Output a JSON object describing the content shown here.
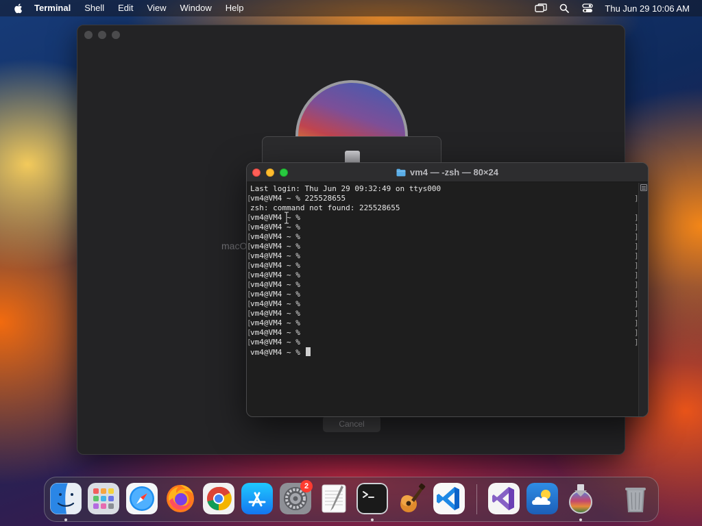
{
  "menubar": {
    "app_name": "Terminal",
    "menus": [
      "Shell",
      "Edit",
      "View",
      "Window",
      "Help"
    ],
    "clock": "Thu Jun 29  10:06 AM",
    "icons": [
      "apple-icon",
      "screen-mirroring-icon",
      "spotlight-search-icon",
      "control-center-icon"
    ]
  },
  "installer": {
    "ghost_text": "macO",
    "cancel_label": "Cancel"
  },
  "terminal": {
    "title": "vm4 — -zsh — 80×24",
    "lines": [
      "Last login: Thu Jun 29 09:32:49 on ttys000",
      "vm4@VM4 ~ % 225528655",
      "zsh: command not found: 225528655",
      "vm4@VM4 ~ %",
      "vm4@VM4 ~ %",
      "vm4@VM4 ~ %",
      "vm4@VM4 ~ %",
      "vm4@VM4 ~ %",
      "vm4@VM4 ~ %",
      "vm4@VM4 ~ %",
      "vm4@VM4 ~ %",
      "vm4@VM4 ~ %",
      "vm4@VM4 ~ %",
      "vm4@VM4 ~ %",
      "vm4@VM4 ~ %",
      "vm4@VM4 ~ %",
      "vm4@VM4 ~ %",
      "vm4@VM4 ~ % "
    ]
  },
  "dock": {
    "items": [
      {
        "name": "Finder",
        "icon": "finder-icon",
        "running": true
      },
      {
        "name": "Launchpad",
        "icon": "launchpad-icon",
        "running": false
      },
      {
        "name": "Safari",
        "icon": "safari-icon",
        "running": false
      },
      {
        "name": "Firefox",
        "icon": "firefox-icon",
        "running": false
      },
      {
        "name": "Google Chrome",
        "icon": "chrome-icon",
        "running": false
      },
      {
        "name": "App Store",
        "icon": "app-store-icon",
        "running": false
      },
      {
        "name": "System Settings",
        "icon": "system-settings-icon",
        "running": false,
        "badge": "2"
      },
      {
        "name": "TextEdit",
        "icon": "textedit-icon",
        "running": false
      },
      {
        "name": "Terminal",
        "icon": "terminal-icon",
        "running": true
      },
      {
        "name": "GarageBand",
        "icon": "garageband-icon",
        "running": false
      },
      {
        "name": "Visual Studio Code",
        "icon": "vscode-icon",
        "running": false
      },
      {
        "name": "Visual Studio",
        "icon": "visual-studio-icon",
        "running": false
      },
      {
        "name": "Weather",
        "icon": "weather-icon",
        "running": false
      },
      {
        "name": "Install macOS",
        "icon": "install-macos-icon",
        "running": true
      },
      {
        "name": "Trash",
        "icon": "trash-icon",
        "running": false
      }
    ]
  },
  "colors": {
    "terminal_bg": "#1e1e1e",
    "close": "#ff5f57",
    "minimize": "#febc2e",
    "zoom": "#28c840",
    "badge": "#ff3b30"
  }
}
